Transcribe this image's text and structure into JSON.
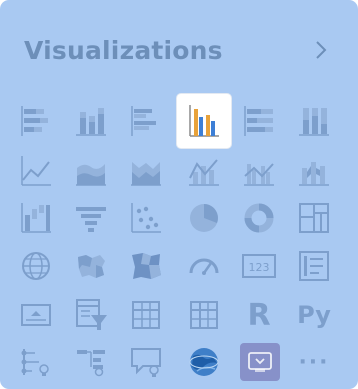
{
  "panel": {
    "title": "Visualizations",
    "expand_icon": "chevron-right-icon"
  },
  "visual_types": [
    {
      "icon": "stacked-bar-chart-icon"
    },
    {
      "icon": "stacked-column-chart-icon"
    },
    {
      "icon": "clustered-bar-chart-icon"
    },
    {
      "icon": "clustered-column-chart-icon",
      "selected": true
    },
    {
      "icon": "100-percent-stacked-bar-chart-icon"
    },
    {
      "icon": "100-percent-stacked-column-chart-icon"
    },
    {
      "icon": "line-chart-icon"
    },
    {
      "icon": "area-chart-icon"
    },
    {
      "icon": "stacked-area-chart-icon"
    },
    {
      "icon": "line-and-stacked-column-chart-icon"
    },
    {
      "icon": "line-and-clustered-column-chart-icon"
    },
    {
      "icon": "ribbon-chart-icon"
    },
    {
      "icon": "waterfall-chart-icon"
    },
    {
      "icon": "funnel-chart-icon"
    },
    {
      "icon": "scatter-chart-icon"
    },
    {
      "icon": "pie-chart-icon"
    },
    {
      "icon": "donut-chart-icon"
    },
    {
      "icon": "treemap-icon"
    },
    {
      "icon": "map-icon"
    },
    {
      "icon": "filled-map-icon"
    },
    {
      "icon": "shape-map-icon"
    },
    {
      "icon": "gauge-icon"
    },
    {
      "icon": "card-icon",
      "label": "123"
    },
    {
      "icon": "multi-row-card-icon"
    },
    {
      "icon": "kpi-icon"
    },
    {
      "icon": "slicer-icon"
    },
    {
      "icon": "table-icon"
    },
    {
      "icon": "matrix-icon"
    },
    {
      "icon": "r-script-visual-icon",
      "label": "R"
    },
    {
      "icon": "python-visual-icon",
      "label": "Py"
    },
    {
      "icon": "key-influencers-icon"
    },
    {
      "icon": "decomposition-tree-icon"
    },
    {
      "icon": "qa-icon"
    },
    {
      "icon": "arcgis-map-icon"
    },
    {
      "icon": "power-apps-icon"
    },
    {
      "icon": "more-options-icon",
      "label": "···"
    }
  ],
  "colors": {
    "panel_bg": "#a9c9f2",
    "icon_muted": "#7d9fcc",
    "selected_bg": "#ffffff",
    "selected_orange": "#e8a23a",
    "selected_blue": "#3d7fd6",
    "power_apps_bg": "#8791c9"
  }
}
